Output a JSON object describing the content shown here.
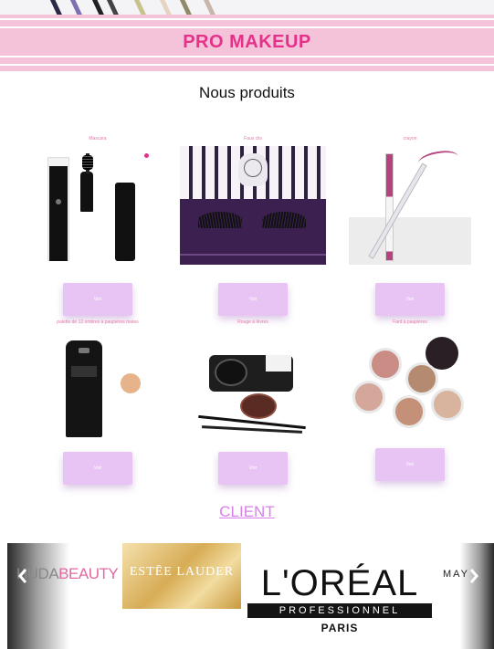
{
  "header": {
    "title": "PRO MAKEUP"
  },
  "products_section": {
    "title": "Nous produits"
  },
  "products": [
    {
      "name": "Mascara",
      "button_label": "Voir"
    },
    {
      "name": "Faux cils",
      "button_label": "Voir"
    },
    {
      "name": "crayon",
      "button_label": "Voir"
    },
    {
      "name": "palette de 12 ombres à paupières mates",
      "button_label": "Voir"
    },
    {
      "name": "Rouge à lèvres",
      "button_label": "Voir"
    },
    {
      "name": "Fard à paupières",
      "button_label": "Voir"
    }
  ],
  "client_section": {
    "title": "CLIENT"
  },
  "clients": {
    "huda": {
      "part1": "HUDA",
      "part2": "BEAUTY"
    },
    "estee": {
      "text": "ESTĒE LAUDER"
    },
    "loreal": {
      "brand": "L'ORÉAL",
      "line": "PROFESSIONNEL",
      "city": "PARIS"
    },
    "maybelline": {
      "text": "MAY"
    }
  },
  "carousel": {
    "prev_icon": "chevron-left-icon",
    "next_icon": "chevron-right-icon"
  },
  "colors": {
    "accent": "#e4318a",
    "header_band": "#f5c3d9",
    "button": "#e7c4f3",
    "client_link": "#d880ea"
  }
}
